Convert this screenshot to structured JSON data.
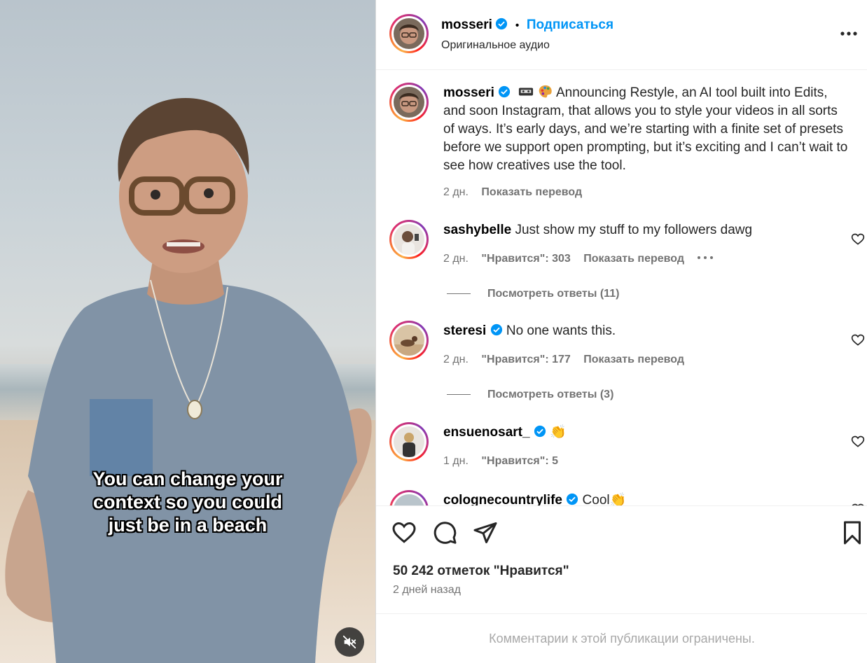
{
  "video": {
    "caption_lines": [
      "You can change your",
      "context so you could",
      "just be in a beach"
    ],
    "mute_icon": "speaker-muted-icon"
  },
  "header": {
    "username": "mosseri",
    "separator": "•",
    "follow_label": "Подписаться",
    "audio": "Оригинальное аудио"
  },
  "post": {
    "username": "mosseri",
    "text": "Announcing Restyle, an AI tool built into Edits, and soon Instagram, that allows you to style your videos in all sorts of ways. It’s early days, and we’re starting with a finite set of presets before we support open prompting, but it’s exciting and I can’t wait to see how creatives use the tool.",
    "time": "2 дн.",
    "translate": "Показать перевод"
  },
  "comments": [
    {
      "username": "sashybelle",
      "verified": false,
      "text": "Just show my stuff to my followers dawg",
      "time": "2 дн.",
      "likes": "\"Нравится\": 303",
      "translate": "Показать перевод",
      "replies": "Посмотреть ответы (11)"
    },
    {
      "username": "steresi",
      "verified": true,
      "text": "No one wants this.",
      "time": "2 дн.",
      "likes": "\"Нравится\": 177",
      "translate": "Показать перевод",
      "replies": "Посмотреть ответы (3)"
    },
    {
      "username": "ensuenosart_",
      "verified": true,
      "text": "👏",
      "time": "1 дн.",
      "likes": "\"Нравится\": 5"
    },
    {
      "username": "colognecountrylife",
      "verified": true,
      "text": "Cool👏"
    }
  ],
  "actions": {
    "likes_count": "50 242 отметок \"Нравится\"",
    "date": "2 дней назад",
    "comments_limited": "Комментарии к этой публикации ограничены."
  },
  "colors": {
    "accent": "#0095f6",
    "muted": "#737373",
    "verified": "#0095f6"
  }
}
